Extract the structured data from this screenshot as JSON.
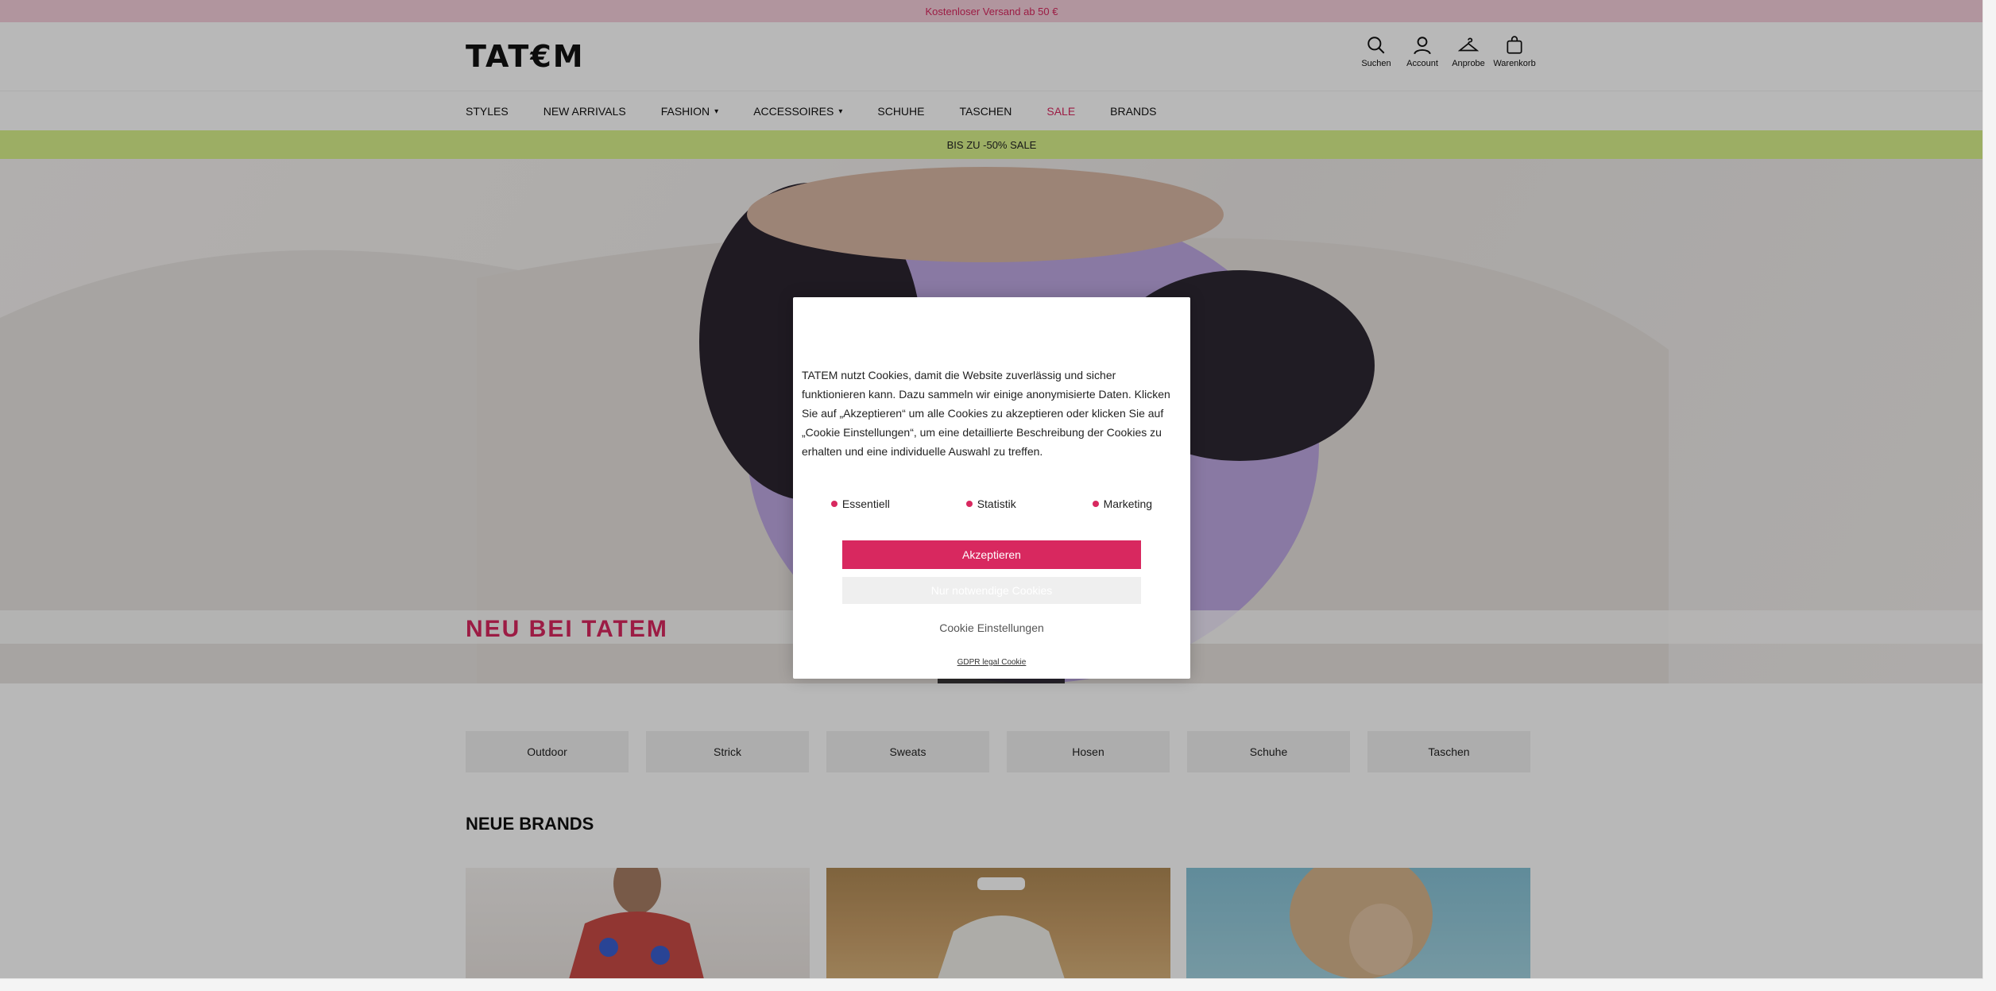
{
  "topbar": {
    "text": "Kostenloser Versand ab 50 €"
  },
  "header": {
    "logo": "TAT€M",
    "icons": [
      {
        "name": "search-icon",
        "label": "Suchen"
      },
      {
        "name": "account-icon",
        "label": "Account"
      },
      {
        "name": "hanger-icon",
        "label": "Anprobe"
      },
      {
        "name": "bag-icon",
        "label": "Warenkorb"
      }
    ]
  },
  "nav": {
    "items": [
      {
        "label": "STYLES"
      },
      {
        "label": "NEW ARRIVALS"
      },
      {
        "label": "FASHION"
      },
      {
        "label": "ACCESSOIRES"
      },
      {
        "label": "SCHUHE"
      },
      {
        "label": "TASCHEN"
      },
      {
        "label": "SALE"
      },
      {
        "label": "BRANDS"
      }
    ]
  },
  "salebar": {
    "text": "BIS ZU -50% SALE"
  },
  "hero": {
    "title": "NEU BEI TATEM"
  },
  "cookie": {
    "text": "TATEM nutzt Cookies, damit die Website zuverlässig und sicher funktionieren kann. Dazu sammeln wir einige anonymisierte Daten. Klicken Sie auf „Akzeptieren“ um alle Cookies zu akzeptieren oder klicken Sie auf „Cookie Einstellungen“, um eine detaillierte Beschreibung der Cookies zu erhalten und eine individuelle Auswahl zu treffen.",
    "categories": [
      "Essentiell",
      "Statistik",
      "Marketing"
    ],
    "accept": "Akzeptieren",
    "necessary": "Nur notwendige Cookies",
    "settings": "Cookie Einstellungen",
    "gdpr": "GDPR legal Cookie",
    "accent": "#d8285f"
  },
  "categories": [
    "Outdoor",
    "Strick",
    "Sweats",
    "Hosen",
    "Schuhe",
    "Taschen"
  ],
  "brands": {
    "title": "NEUE BRANDS"
  }
}
